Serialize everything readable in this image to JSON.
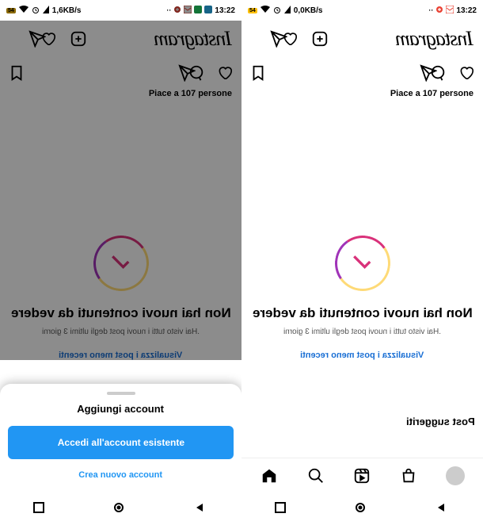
{
  "status": {
    "left": {
      "time": "13:22",
      "kbps": "1,6KB/s"
    },
    "right": {
      "time": "13:22",
      "kbps": "0,0KB/s"
    }
  },
  "header": {
    "logo_text": "Instagram"
  },
  "post": {
    "likes_text": "Piace a 107 persone"
  },
  "feed": {
    "title": "Non hai nuovi contenuti da vedere",
    "sub": "Hai visto tutti i nuovi post degli ultimi 3 giorni.",
    "link": "Visualizza i post meno recenti"
  },
  "suggested_label": "Post suggeriti",
  "sheet": {
    "title": "Aggiungi account",
    "login_btn": "Accedi all'account esistente",
    "create_btn": "Crea nuovo account"
  }
}
